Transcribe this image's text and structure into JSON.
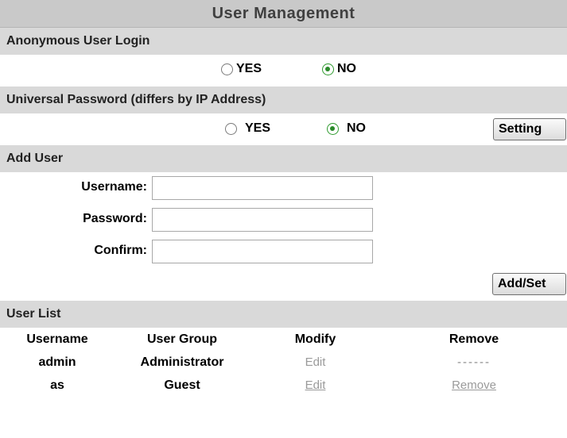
{
  "title": "User Management",
  "anonymous": {
    "label": "Anonymous User Login",
    "yes_label": "YES",
    "no_label": "NO",
    "selected": "NO"
  },
  "universal": {
    "label": "Universal Password (differs by IP Address)",
    "yes_label": "YES",
    "no_label": "NO",
    "selected": "NO",
    "setting_button": "Setting"
  },
  "add_user": {
    "label": "Add User",
    "username_label": "Username:",
    "password_label": "Password:",
    "confirm_label": "Confirm:",
    "username_value": "",
    "password_value": "",
    "confirm_value": "",
    "add_button": "Add/Set"
  },
  "user_list": {
    "label": "User List",
    "headers": [
      "Username",
      "User Group",
      "Modify",
      "Remove"
    ],
    "rows": [
      {
        "username": "admin",
        "group": "Administrator",
        "modify": "Edit",
        "remove": "------"
      },
      {
        "username": "as",
        "group": "Guest",
        "modify": "Edit",
        "remove": "Remove"
      }
    ]
  },
  "colors": {
    "section_bg": "#d9d9d9",
    "title_bg": "#c9c9c9",
    "radio_checked": "#2a8a2a",
    "link": "#9a9a9a"
  }
}
